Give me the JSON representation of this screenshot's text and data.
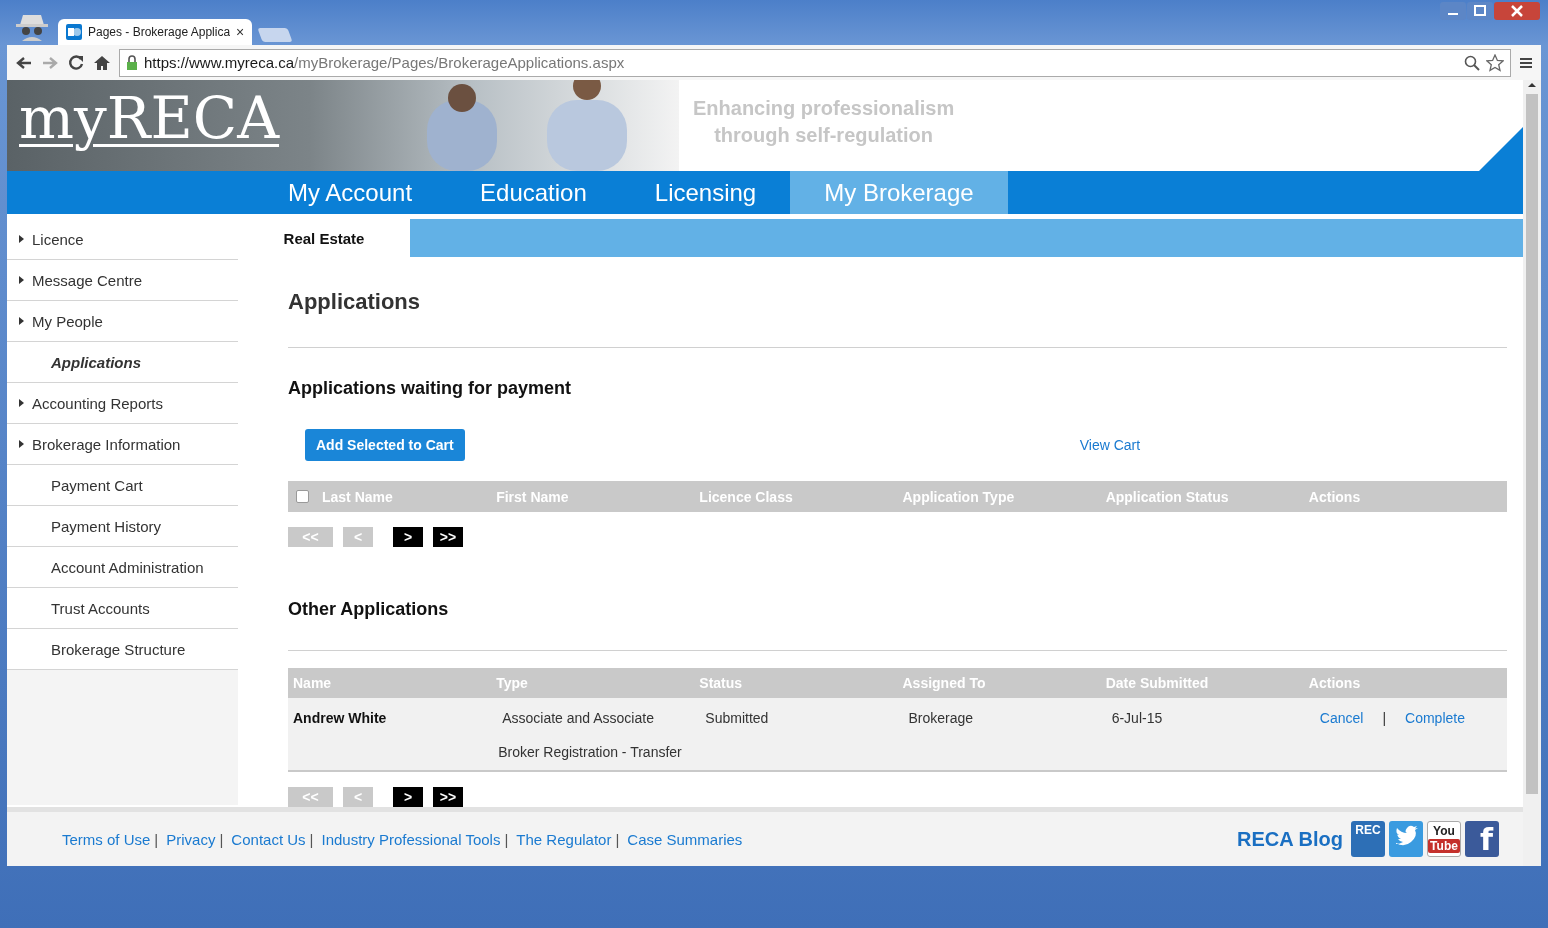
{
  "browser": {
    "tab_title": "Pages - Brokerage Applica",
    "tab_close": "×",
    "url_host": "https://www.myreca.ca",
    "url_path": "/myBrokerage/Pages/BrokerageApplications.aspx"
  },
  "header": {
    "logo": "myRECA",
    "tagline_1": "Enhancing professionalism",
    "tagline_2": "through self-regulation"
  },
  "nav": [
    {
      "label": "My Account",
      "selected": false
    },
    {
      "label": "Education",
      "selected": false
    },
    {
      "label": "Licensing",
      "selected": false
    },
    {
      "label": "My Brokerage",
      "selected": true
    }
  ],
  "subtabs": [
    {
      "label": "Real Estate",
      "selected": true
    }
  ],
  "sidebar": {
    "items": [
      {
        "label": "Licence",
        "kind": "expandable",
        "selected": false
      },
      {
        "label": "Message Centre",
        "kind": "expandable",
        "selected": false
      },
      {
        "label": "My People",
        "kind": "expandable",
        "selected": false
      },
      {
        "label": "Applications",
        "kind": "plain",
        "selected": true
      },
      {
        "label": "Accounting Reports",
        "kind": "expandable",
        "selected": false
      },
      {
        "label": "Brokerage Information",
        "kind": "expandable",
        "selected": false
      },
      {
        "label": "Payment Cart",
        "kind": "plain",
        "selected": false
      },
      {
        "label": "Payment History",
        "kind": "plain",
        "selected": false
      },
      {
        "label": "Account Administration",
        "kind": "plain",
        "selected": false
      },
      {
        "label": "Trust Accounts",
        "kind": "plain",
        "selected": false
      },
      {
        "label": "Brokerage Structure",
        "kind": "plain",
        "selected": false
      }
    ]
  },
  "page_title": "Applications",
  "waiting": {
    "title": "Applications waiting for payment",
    "add_button": "Add Selected to Cart",
    "view_cart": "View Cart",
    "select_all_checked": false,
    "columns": [
      "Last Name",
      "First Name",
      "Licence Class",
      "Application Type",
      "Application Status",
      "Actions"
    ],
    "pager": [
      {
        "label": "<<",
        "disabled": true
      },
      {
        "label": "<",
        "disabled": true
      },
      {
        "label": ">",
        "disabled": false
      },
      {
        "label": ">>",
        "disabled": false
      }
    ]
  },
  "other": {
    "title": "Other Applications",
    "columns": [
      "Name",
      "Type",
      "Status",
      "Assigned To",
      "Date Submitted",
      "Actions"
    ],
    "rows": [
      {
        "name": "Andrew White",
        "type_1": "Associate and Associate",
        "type_2": "Broker Registration - Transfer",
        "status": "Submitted",
        "assigned_to": "Brokerage",
        "date_submitted": "6-Jul-15",
        "actions": [
          "Cancel",
          "Complete"
        ],
        "separator": "|"
      }
    ],
    "pager": [
      {
        "label": "<<",
        "disabled": true
      },
      {
        "label": "<",
        "disabled": true
      },
      {
        "label": ">",
        "disabled": false
      },
      {
        "label": ">>",
        "disabled": false
      }
    ]
  },
  "footer": {
    "links": [
      "Terms of Use",
      "Privacy",
      "Contact Us",
      "Industry Professional Tools",
      "The Regulator",
      "Case Summaries"
    ],
    "separator": "|",
    "blog": "RECA Blog",
    "blog_icon": "REC",
    "youtube_1": "You",
    "youtube_2": "Tube",
    "facebook": "f"
  }
}
